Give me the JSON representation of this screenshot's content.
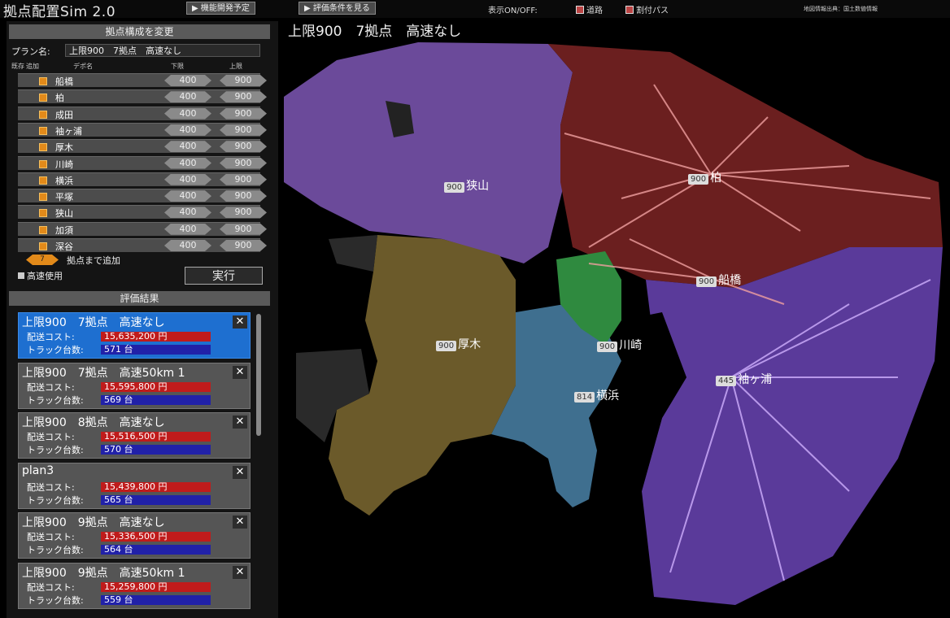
{
  "app": {
    "title": "拠点配置Sim 2.0",
    "btn_future": "▶ 機能開発予定",
    "btn_eval": "▶ 評価条件を見る",
    "toggle_label": "表示ON/OFF:",
    "toggle_road": "道路",
    "toggle_path": "割付パス",
    "attribution": "地図情報出典：国土数値情報"
  },
  "config": {
    "header": "拠点構成を変更",
    "plan_label": "プラン名:",
    "plan_name": "上限900　7拠点　高速なし",
    "col_keep": "既存",
    "col_add": "追加",
    "col_name": "デポ名",
    "col_lower": "下限",
    "col_upper": "上限",
    "bases": [
      {
        "name": "船橋",
        "lower": "400",
        "upper": "900"
      },
      {
        "name": "柏",
        "lower": "400",
        "upper": "900"
      },
      {
        "name": "成田",
        "lower": "400",
        "upper": "900"
      },
      {
        "name": "袖ヶ浦",
        "lower": "400",
        "upper": "900"
      },
      {
        "name": "厚木",
        "lower": "400",
        "upper": "900"
      },
      {
        "name": "川崎",
        "lower": "400",
        "upper": "900"
      },
      {
        "name": "横浜",
        "lower": "400",
        "upper": "900"
      },
      {
        "name": "平塚",
        "lower": "400",
        "upper": "900"
      },
      {
        "name": "狭山",
        "lower": "400",
        "upper": "900"
      },
      {
        "name": "加須",
        "lower": "400",
        "upper": "900"
      },
      {
        "name": "深谷",
        "lower": "400",
        "upper": "900"
      }
    ],
    "spinner_value": "7",
    "spinner_label": "拠点まで追加",
    "highway_label": "高速使用",
    "run_label": "実行"
  },
  "results": {
    "header": "評価結果",
    "cost_label": "配送コスト:",
    "truck_label": "トラック台数:",
    "close": "✕",
    "items": [
      {
        "title": "上限900　7拠点　高速なし",
        "cost": "15,635,200 円",
        "trucks": "571 台",
        "selected": true
      },
      {
        "title": "上限900　7拠点　高速50km 1",
        "cost": "15,595,800 円",
        "trucks": "569 台",
        "selected": false
      },
      {
        "title": "上限900　8拠点　高速なし",
        "cost": "15,516,500 円",
        "trucks": "570 台",
        "selected": false
      },
      {
        "title": "plan3",
        "cost": "15,439,800 円",
        "trucks": "565 台",
        "selected": false
      },
      {
        "title": "上限900　9拠点　高速なし",
        "cost": "15,336,500 円",
        "trucks": "564 台",
        "selected": false
      },
      {
        "title": "上限900　9拠点　高速50km 1",
        "cost": "15,259,800 円",
        "trucks": "559 台",
        "selected": false
      }
    ]
  },
  "map": {
    "title": "上限900　7拠点　高速なし",
    "sites": [
      {
        "id": "sayama",
        "value": "900",
        "name": "狭山"
      },
      {
        "id": "kashiwa",
        "value": "900",
        "name": "柏"
      },
      {
        "id": "funabashi",
        "value": "900",
        "name": "船橋"
      },
      {
        "id": "atsugi",
        "value": "900",
        "name": "厚木"
      },
      {
        "id": "kawasaki",
        "value": "900",
        "name": "川崎"
      },
      {
        "id": "sodegaura",
        "value": "445",
        "name": "袖ヶ浦"
      },
      {
        "id": "yokohama",
        "value": "814",
        "name": "横浜"
      }
    ],
    "colors": {
      "purple": "#6b4a9a",
      "maroon": "#6b1f1f",
      "olive": "#6b5a2a",
      "steel": "#3f6f8f",
      "green": "#2f8a3f",
      "chiba": "#5a3a9a"
    }
  }
}
